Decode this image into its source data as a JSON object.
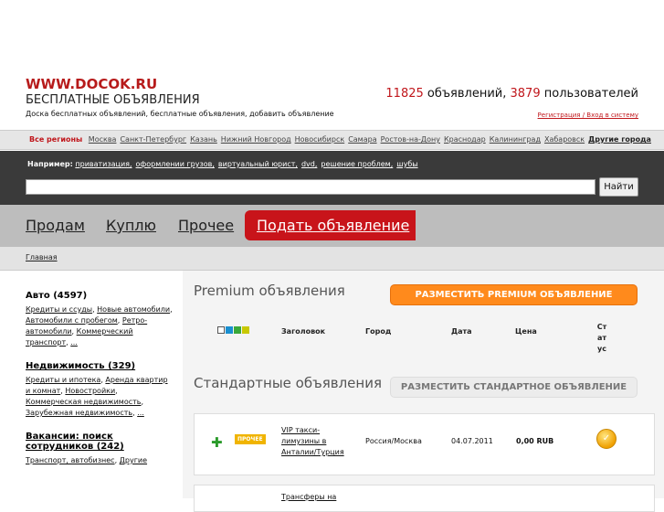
{
  "header": {
    "logo": "WWW.DOCOK.RU",
    "tagline": "БЕСПЛАТНЫЕ ОБЪЯВЛЕНИЯ",
    "description": "Доска бесплатных объявлений, бесплатные объявления, добавить объявление",
    "ads_count": "11825",
    "ads_label": " объявлений, ",
    "users_count": "3879",
    "users_label": " пользователей",
    "register_link": "Регистрация / Вход в систему"
  },
  "regions": {
    "all": "Все регионы",
    "cities": [
      "Москва",
      "Санкт-Петербург",
      "Казань",
      "Нижний Новгород",
      "Новосибирск",
      "Самара",
      "Ростов-на-Дону",
      "Краснодар",
      "Калининград",
      "Хабаровск"
    ],
    "other": "Другие города"
  },
  "search": {
    "examples_label": "Например:",
    "examples": [
      "приватизация,",
      "оформлении грузов,",
      "виртуальный юрист,",
      "dvd,",
      "решение проблем,",
      "шубы"
    ],
    "button": "Найти",
    "value": ""
  },
  "nav": {
    "sell": "Продам",
    "buy": "Куплю",
    "other": "Прочее",
    "post": "Подать объявление"
  },
  "breadcrumb": {
    "home": "Главная"
  },
  "sidebar": {
    "categories": [
      {
        "title": "Авто (4597)",
        "underline": false,
        "links": [
          "Кредиты и ссуды",
          "Новые автомобили",
          "Автомобили с пробегом",
          "Ретро-автомобили",
          "Коммерческий транспорт",
          "..."
        ]
      },
      {
        "title": "Недвижимость (329)",
        "underline": true,
        "links": [
          "Кредиты и ипотека",
          "Аренда квартир и комнат",
          "Новостройки",
          "Коммерческая недвижимость",
          "Зарубежная недвижимость",
          "..."
        ]
      },
      {
        "title": "Вакансии: поиск сотрудников (242)",
        "underline": true,
        "links": [
          "Транспорт, автобизнес",
          "Другие"
        ]
      }
    ]
  },
  "main": {
    "premium_title": "Premium объявления",
    "premium_button": "РАЗМЕСТИТЬ PREMIUM ОБЪЯВЛЕНИЕ",
    "standard_title": "Стандартные объявления",
    "standard_button": "РАЗМЕСТИТЬ СТАНДАРТНОЕ ОБЪЯВЛЕНИЕ",
    "columns": {
      "title": "Заголовок",
      "city": "Город",
      "date": "Дата",
      "price": "Цена",
      "status": "Статус"
    },
    "swatch_colors": [
      "#ffffff",
      "#1a8fd0",
      "#3aa83a",
      "#c8c800"
    ],
    "rows": [
      {
        "badge": "ПРОЧЕЕ",
        "title": "VIP такси-лимузины в Анталии/Турция",
        "city": "Россия/Москва",
        "date": "04.07.2011",
        "price": "0,00 RUB"
      },
      {
        "title": "Трансферы на"
      }
    ]
  }
}
